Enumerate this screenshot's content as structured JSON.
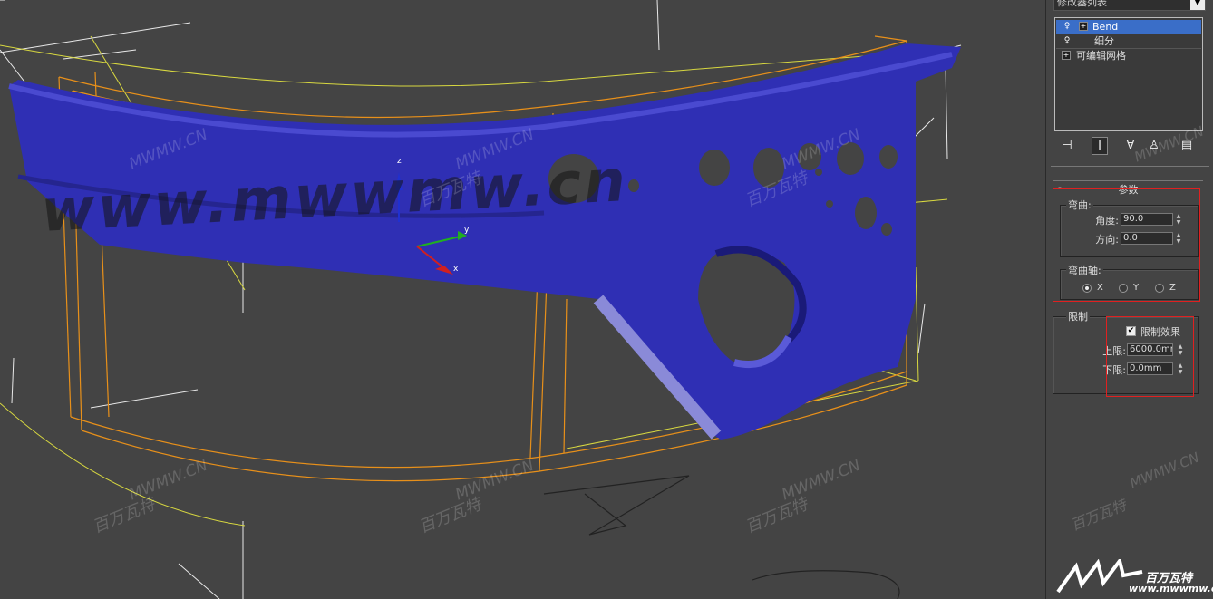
{
  "modifier_list_dropdown": "修改器列表",
  "modifier_stack": [
    {
      "label": "Bend",
      "selected": true,
      "has_bulb": true,
      "has_expand": true
    },
    {
      "label": "细分",
      "selected": false,
      "has_bulb": true,
      "has_expand": false
    },
    {
      "label": "可编辑网格",
      "selected": false,
      "has_bulb": false,
      "has_expand": true
    }
  ],
  "stack_toolbar_icons": [
    "pin-stack-icon",
    "show-end-result-icon",
    "make-unique-icon",
    "remove-modifier-icon",
    "configure-modifier-sets-icon"
  ],
  "params_rollout": {
    "title": "参数",
    "collapse_symbol": "-",
    "bend_group": {
      "label": "弯曲:",
      "angle_label": "角度:",
      "angle_value": "90.0",
      "direction_label": "方向:",
      "direction_value": "0.0"
    },
    "axis_group": {
      "label": "弯曲轴:",
      "options": [
        "X",
        "Y",
        "Z"
      ],
      "selected": "X"
    },
    "limit_group": {
      "label": "限制",
      "limit_effect_label": "限制效果",
      "limit_effect_checked": true,
      "upper_label": "上限:",
      "upper_value": "6000.0mm",
      "lower_label": "下限:",
      "lower_value": "0.0mm"
    }
  },
  "viewport": {
    "axis_labels": {
      "z": "z",
      "y": "y",
      "x": "x"
    },
    "mesh_color": "#3030b8",
    "watermark_big": "www.mwwmw.cn",
    "watermark_small": "MWMW.CN",
    "watermark_cn": "百万瓦特"
  },
  "logo": {
    "brand": "百万瓦特",
    "url": "www.mwwmw.cn"
  },
  "colors": {
    "viewport_bg": "#444444",
    "selection_blue": "#3a6ec8",
    "highlight_red": "#e02020",
    "bbox_orange": "#e8901a",
    "gizmo_yellow": "#d8d840"
  }
}
